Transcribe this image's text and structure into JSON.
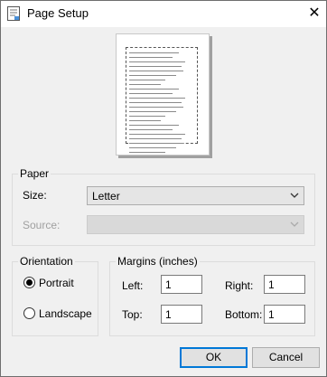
{
  "window": {
    "title": "Page Setup",
    "close_glyph": "✕"
  },
  "preview": {
    "lines": 23
  },
  "paper": {
    "legend": "Paper",
    "size_label": "Size:",
    "size_value": "Letter",
    "source_label": "Source:",
    "source_value": ""
  },
  "orientation": {
    "legend": "Orientation",
    "portrait_label": "Portrait",
    "landscape_label": "Landscape",
    "selected": "Portrait"
  },
  "margins": {
    "legend": "Margins (inches)",
    "left_label": "Left:",
    "left_value": "1",
    "right_label": "Right:",
    "right_value": "1",
    "top_label": "Top:",
    "top_value": "1",
    "bottom_label": "Bottom:",
    "bottom_value": "1"
  },
  "buttons": {
    "ok": "OK",
    "cancel": "Cancel"
  },
  "colors": {
    "accent": "#0078d7",
    "dialog_bg": "#f0f0f0"
  },
  "icons": [
    "page-setup-app-icon",
    "close-icon",
    "chevron-down-icon"
  ]
}
